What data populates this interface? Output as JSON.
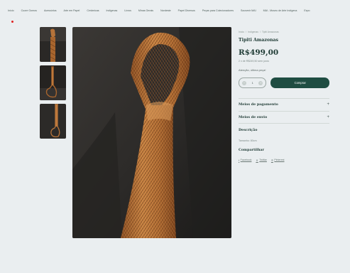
{
  "nav": {
    "items": [
      "Início",
      "Cuore Gomos",
      "Acessórios",
      "Arte em Papel",
      "Cerâmicas",
      "Indígenas",
      "Livros",
      "Minas Gerais",
      "Nordeste",
      "Papel Diversos",
      "Peças para Colecionadores",
      "Souvenir MAI",
      "MAI - Museu de Arte Indígena",
      "Expo"
    ]
  },
  "breadcrumb": {
    "items": [
      "Início",
      "/",
      "Indígenas",
      "/",
      "Tipiti Amazonas"
    ]
  },
  "product": {
    "title": "Tipiti Amazonas",
    "price": "R$499,00",
    "installments": "2 x de R$249,50 sem juros",
    "stock_note": "Atenção, última peça!",
    "quantity": "1",
    "buy_label": "Comprar"
  },
  "sections": {
    "payment": "Meios de pagamento",
    "shipping": "Meios de envio",
    "description_title": "Descrição",
    "description_text": "Tamanho: 80cm",
    "share_title": "Compartilhar"
  },
  "share": {
    "facebook": "Facebook",
    "twitter": "Twittar",
    "pinterest": "Pinterest"
  },
  "icons": {
    "plus": "+",
    "minus": "−"
  },
  "colors": {
    "accent": "#1f4d42",
    "background": "#eaeef0",
    "cart_badge": "#e02020"
  }
}
